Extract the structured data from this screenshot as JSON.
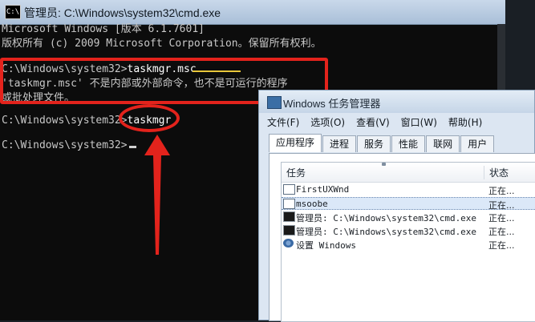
{
  "cmd": {
    "title": "管理员: C:\\Windows\\system32\\cmd.exe",
    "icon_glyph": "C:\\",
    "lines": {
      "l1": "Microsoft Windows [版本 6.1.7601]",
      "l2": "版权所有 (c) 2009 Microsoft Corporation。保留所有权利。",
      "l3_prompt": "C:\\Windows\\system32>",
      "l3_command": "taskmgr.msc",
      "l4": "'taskmgr.msc' 不是内部或外部命令，也不是可运行的程序",
      "l5": "或批处理文件。",
      "l6_prompt": "C:\\Windows\\system32>",
      "l6_command": "taskmgr",
      "l7_prompt": "C:\\Windows\\system32>"
    }
  },
  "annotation": {
    "color": "#e3231c",
    "icon": "red-arrow-up-icon"
  },
  "taskmgr": {
    "title": "Windows 任务管理器",
    "menu": [
      "文件(F)",
      "选项(O)",
      "查看(V)",
      "窗口(W)",
      "帮助(H)"
    ],
    "tabs": [
      "应用程序",
      "进程",
      "服务",
      "性能",
      "联网",
      "用户"
    ],
    "columns": {
      "task": "任务",
      "status": "状态"
    },
    "rows": [
      {
        "task": "FirstUXWnd",
        "status": "正在...",
        "icon": "window-icon"
      },
      {
        "task": "msoobe",
        "status": "正在...",
        "icon": "window-icon"
      },
      {
        "task": "管理员: C:\\Windows\\system32\\cmd.exe",
        "status": "正在...",
        "icon": "cmd-icon"
      },
      {
        "task": "管理员: C:\\Windows\\system32\\cmd.exe",
        "status": "正在...",
        "icon": "cmd-icon"
      },
      {
        "task": "设置 Windows",
        "status": "正在...",
        "icon": "settings-icon"
      }
    ]
  }
}
